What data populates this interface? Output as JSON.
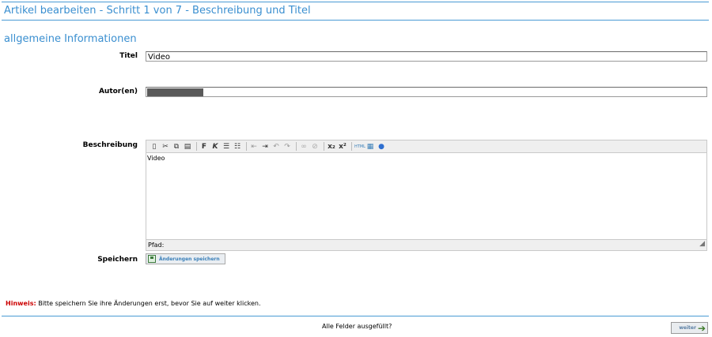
{
  "header": {
    "title": "Artikel bearbeiten - Schritt 1 von 7 - Beschreibung und Titel"
  },
  "section": {
    "title": "allgemeine Informationen"
  },
  "form": {
    "title_label": "Titel",
    "title_value": "Video",
    "author_label": "Autor(en)",
    "description_label": "Beschreibung",
    "description_content": "Video",
    "editor_path_label": "Pfad:",
    "save_label": "Speichern",
    "save_button": "Änderungen speichern"
  },
  "toolbar_icons": [
    "new-doc-icon",
    "cut-icon",
    "copy-icon",
    "paste-icon",
    "bold-icon",
    "italic-icon",
    "bullet-list-icon",
    "numbered-list-icon",
    "outdent-icon",
    "indent-icon",
    "undo-icon",
    "redo-icon",
    "link-icon",
    "unlink-icon",
    "subscript-icon",
    "superscript-icon",
    "html-icon",
    "table-icon",
    "help-icon"
  ],
  "footer": {
    "hint_key": "Hinweis:",
    "hint_text": " Bitte speichern Sie ihre Änderungen erst, bevor Sie auf weiter klicken.",
    "complete_text": "Alle Felder ausgefüllt?",
    "next_button": "weiter"
  },
  "colors": {
    "accent": "#3a8fd0",
    "hint": "#cc0000"
  }
}
